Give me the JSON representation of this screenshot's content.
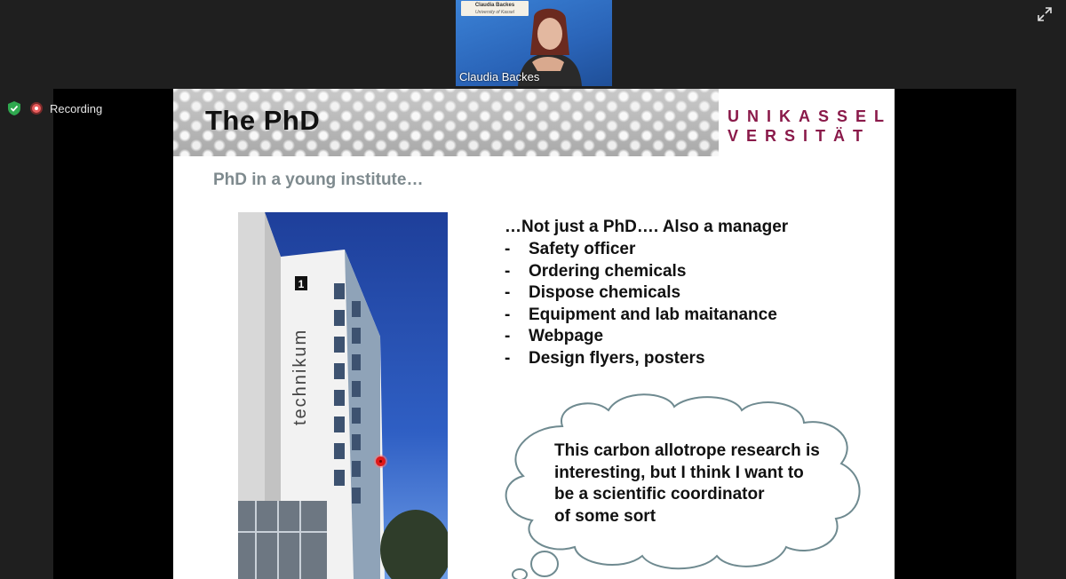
{
  "meeting": {
    "participant_name": "Claudia Backes",
    "name_card_line1": "Claudia Backes",
    "name_card_line2": "University of Kassel",
    "recording_label": "Recording"
  },
  "slide": {
    "title": "The PhD",
    "logo_line1": "UNIKASSEL",
    "logo_line2": "VERSITÄT",
    "subtitle": "PhD in a young institute…",
    "photo_sign": "technikum",
    "photo_number": "1",
    "list_heading": "…Not just a PhD…. Also a manager",
    "list_items": [
      "Safety officer",
      "Ordering chemicals",
      "Dispose chemicals",
      "Equipment and lab maitanance",
      "Webpage",
      "Design flyers, posters"
    ],
    "thought_lines": [
      "This carbon allotrope research is",
      "interesting, but I think I want to",
      "be a scientific coordinator",
      "of some sort"
    ]
  },
  "colors": {
    "logo": "#8a1a4a",
    "subtitle": "#7e8a8e",
    "self_video_bg": "#2f6fc1",
    "shield": "#2fa84f",
    "recording": "#e85c5c"
  }
}
